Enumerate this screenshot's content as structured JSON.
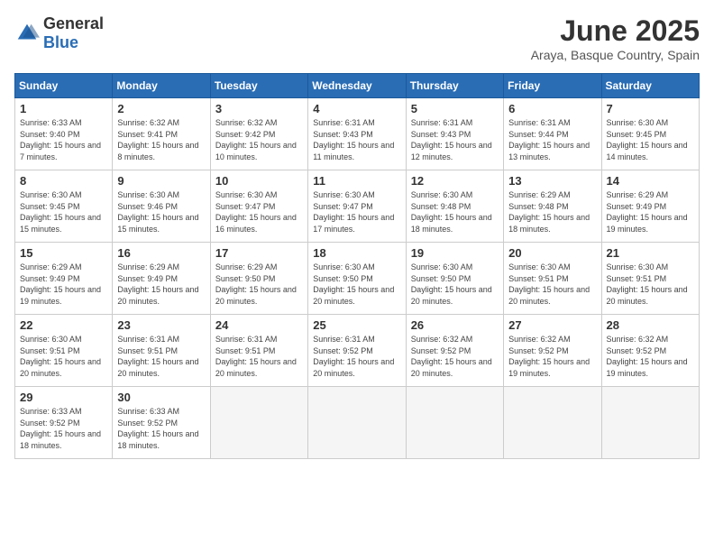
{
  "logo": {
    "general": "General",
    "blue": "Blue"
  },
  "title": "June 2025",
  "location": "Araya, Basque Country, Spain",
  "days_of_week": [
    "Sunday",
    "Monday",
    "Tuesday",
    "Wednesday",
    "Thursday",
    "Friday",
    "Saturday"
  ],
  "weeks": [
    [
      {
        "num": "1",
        "sunrise": "6:33 AM",
        "sunset": "9:40 PM",
        "daylight": "15 hours and 7 minutes."
      },
      {
        "num": "2",
        "sunrise": "6:32 AM",
        "sunset": "9:41 PM",
        "daylight": "15 hours and 8 minutes."
      },
      {
        "num": "3",
        "sunrise": "6:32 AM",
        "sunset": "9:42 PM",
        "daylight": "15 hours and 10 minutes."
      },
      {
        "num": "4",
        "sunrise": "6:31 AM",
        "sunset": "9:43 PM",
        "daylight": "15 hours and 11 minutes."
      },
      {
        "num": "5",
        "sunrise": "6:31 AM",
        "sunset": "9:43 PM",
        "daylight": "15 hours and 12 minutes."
      },
      {
        "num": "6",
        "sunrise": "6:31 AM",
        "sunset": "9:44 PM",
        "daylight": "15 hours and 13 minutes."
      },
      {
        "num": "7",
        "sunrise": "6:30 AM",
        "sunset": "9:45 PM",
        "daylight": "15 hours and 14 minutes."
      }
    ],
    [
      {
        "num": "8",
        "sunrise": "6:30 AM",
        "sunset": "9:45 PM",
        "daylight": "15 hours and 15 minutes."
      },
      {
        "num": "9",
        "sunrise": "6:30 AM",
        "sunset": "9:46 PM",
        "daylight": "15 hours and 15 minutes."
      },
      {
        "num": "10",
        "sunrise": "6:30 AM",
        "sunset": "9:47 PM",
        "daylight": "15 hours and 16 minutes."
      },
      {
        "num": "11",
        "sunrise": "6:30 AM",
        "sunset": "9:47 PM",
        "daylight": "15 hours and 17 minutes."
      },
      {
        "num": "12",
        "sunrise": "6:30 AM",
        "sunset": "9:48 PM",
        "daylight": "15 hours and 18 minutes."
      },
      {
        "num": "13",
        "sunrise": "6:29 AM",
        "sunset": "9:48 PM",
        "daylight": "15 hours and 18 minutes."
      },
      {
        "num": "14",
        "sunrise": "6:29 AM",
        "sunset": "9:49 PM",
        "daylight": "15 hours and 19 minutes."
      }
    ],
    [
      {
        "num": "15",
        "sunrise": "6:29 AM",
        "sunset": "9:49 PM",
        "daylight": "15 hours and 19 minutes."
      },
      {
        "num": "16",
        "sunrise": "6:29 AM",
        "sunset": "9:49 PM",
        "daylight": "15 hours and 20 minutes."
      },
      {
        "num": "17",
        "sunrise": "6:29 AM",
        "sunset": "9:50 PM",
        "daylight": "15 hours and 20 minutes."
      },
      {
        "num": "18",
        "sunrise": "6:30 AM",
        "sunset": "9:50 PM",
        "daylight": "15 hours and 20 minutes."
      },
      {
        "num": "19",
        "sunrise": "6:30 AM",
        "sunset": "9:50 PM",
        "daylight": "15 hours and 20 minutes."
      },
      {
        "num": "20",
        "sunrise": "6:30 AM",
        "sunset": "9:51 PM",
        "daylight": "15 hours and 20 minutes."
      },
      {
        "num": "21",
        "sunrise": "6:30 AM",
        "sunset": "9:51 PM",
        "daylight": "15 hours and 20 minutes."
      }
    ],
    [
      {
        "num": "22",
        "sunrise": "6:30 AM",
        "sunset": "9:51 PM",
        "daylight": "15 hours and 20 minutes."
      },
      {
        "num": "23",
        "sunrise": "6:31 AM",
        "sunset": "9:51 PM",
        "daylight": "15 hours and 20 minutes."
      },
      {
        "num": "24",
        "sunrise": "6:31 AM",
        "sunset": "9:51 PM",
        "daylight": "15 hours and 20 minutes."
      },
      {
        "num": "25",
        "sunrise": "6:31 AM",
        "sunset": "9:52 PM",
        "daylight": "15 hours and 20 minutes."
      },
      {
        "num": "26",
        "sunrise": "6:32 AM",
        "sunset": "9:52 PM",
        "daylight": "15 hours and 20 minutes."
      },
      {
        "num": "27",
        "sunrise": "6:32 AM",
        "sunset": "9:52 PM",
        "daylight": "15 hours and 19 minutes."
      },
      {
        "num": "28",
        "sunrise": "6:32 AM",
        "sunset": "9:52 PM",
        "daylight": "15 hours and 19 minutes."
      }
    ],
    [
      {
        "num": "29",
        "sunrise": "6:33 AM",
        "sunset": "9:52 PM",
        "daylight": "15 hours and 18 minutes."
      },
      {
        "num": "30",
        "sunrise": "6:33 AM",
        "sunset": "9:52 PM",
        "daylight": "15 hours and 18 minutes."
      },
      null,
      null,
      null,
      null,
      null
    ]
  ]
}
